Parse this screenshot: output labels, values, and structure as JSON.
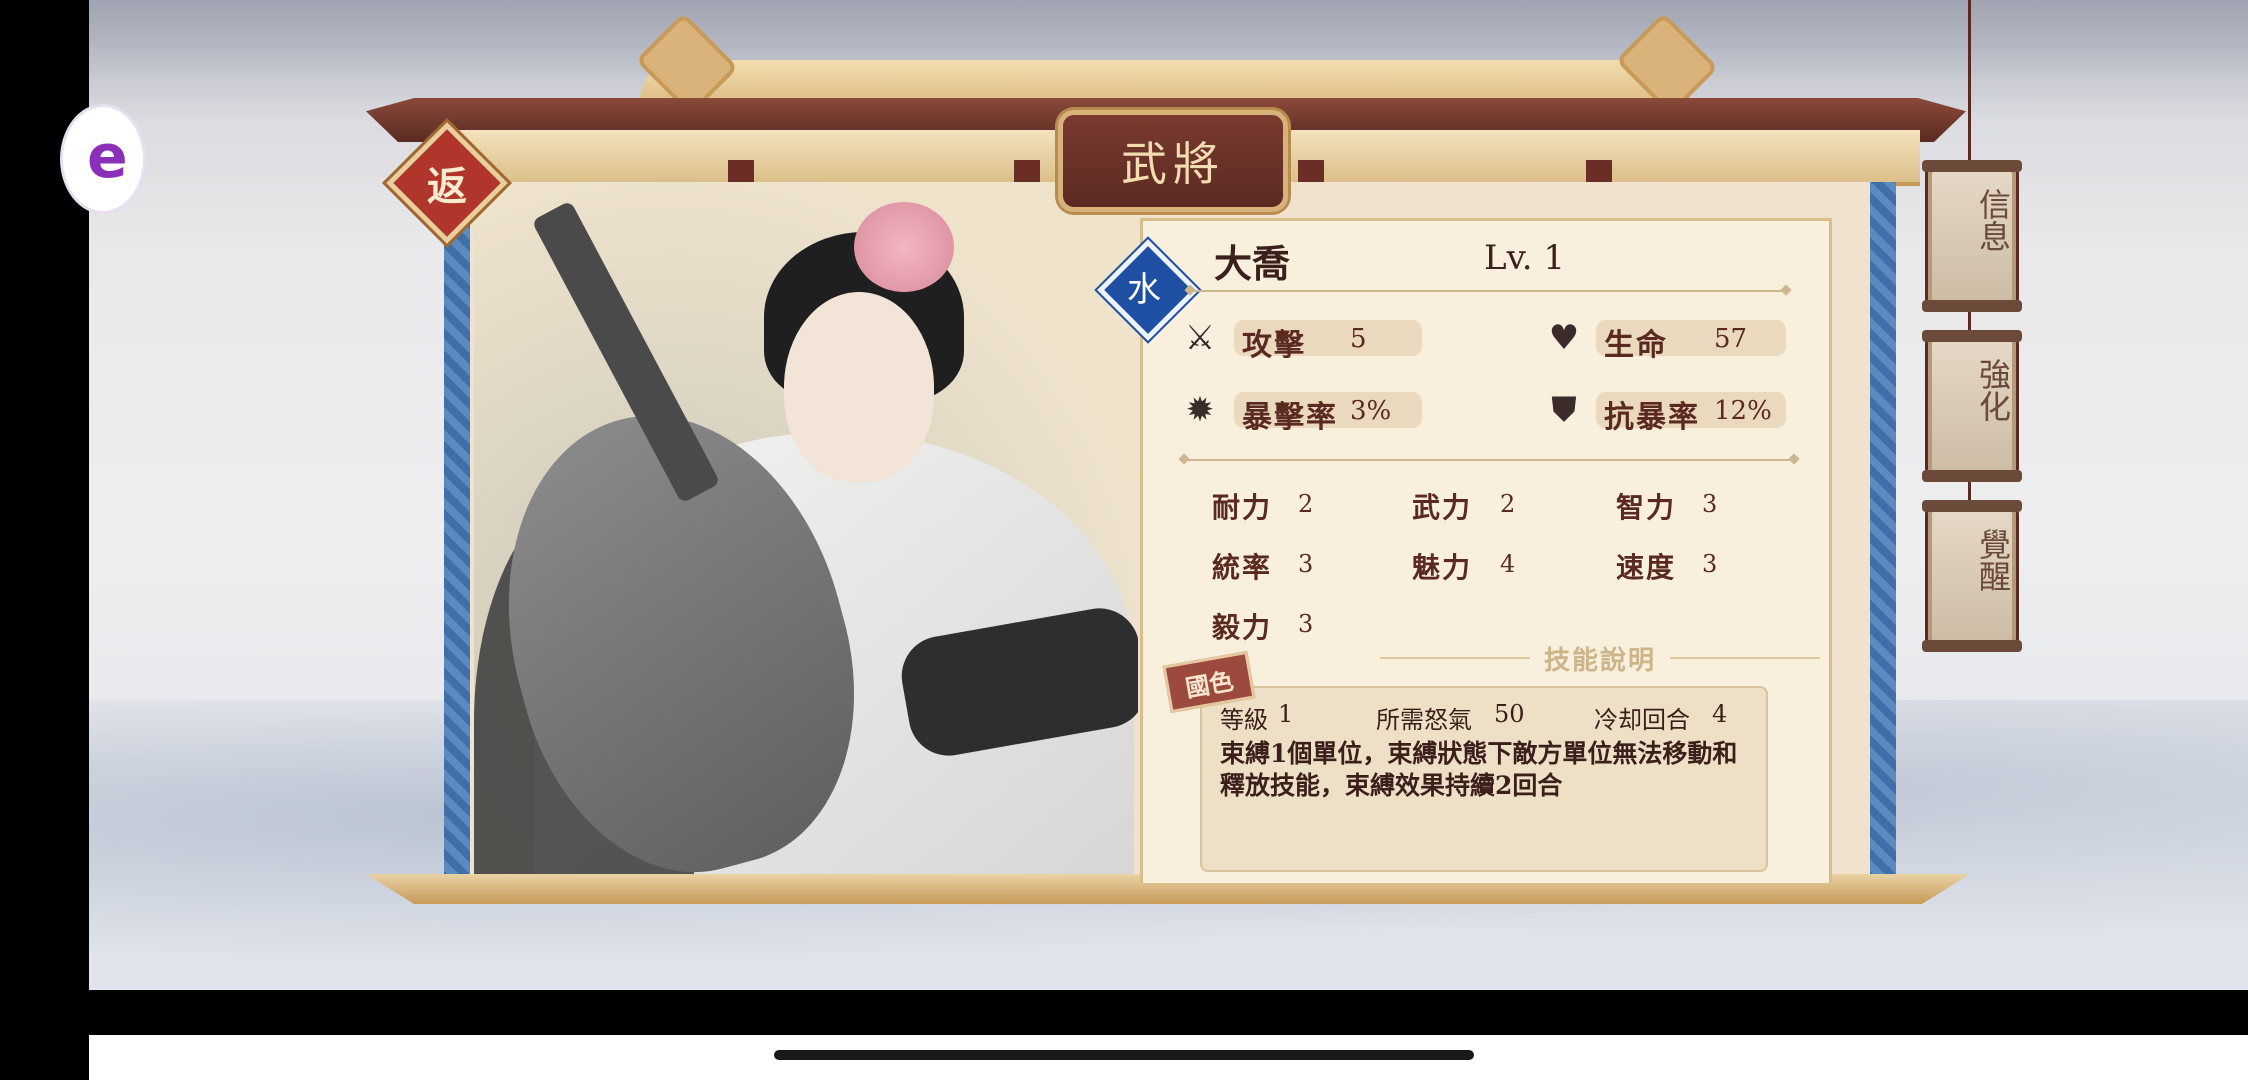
{
  "header": {
    "title": "武將",
    "back_label": "返",
    "user_badge_glyph": "e"
  },
  "hero": {
    "name": "大喬",
    "level": "Lv. 1",
    "element_glyph": "水"
  },
  "combat_stats": [
    {
      "icon": "sword-icon",
      "label": "攻擊",
      "value": "5"
    },
    {
      "icon": "heart-icon",
      "label": "生命",
      "value": "57"
    },
    {
      "icon": "burst-icon",
      "label": "暴擊率",
      "value": "3%"
    },
    {
      "icon": "shield-icon",
      "label": "抗暴率",
      "value": "12%"
    }
  ],
  "attributes": [
    {
      "label": "耐力",
      "value": "2"
    },
    {
      "label": "武力",
      "value": "2"
    },
    {
      "label": "智力",
      "value": "3"
    },
    {
      "label": "統率",
      "value": "3"
    },
    {
      "label": "魅力",
      "value": "4"
    },
    {
      "label": "速度",
      "value": "3"
    },
    {
      "label": "毅力",
      "value": "3"
    }
  ],
  "skill": {
    "section_title": "技能說明",
    "tag": "國色",
    "level_label": "等級",
    "level_value": "1",
    "rage_label": "所需怒氣",
    "rage_value": "50",
    "cooldown_label": "冷却回合",
    "cooldown_value": "4",
    "description": "束縛1個單位，束縛狀態下敵方單位無法移動和釋放技能，束縛效果持續2回合"
  },
  "side_tabs": [
    {
      "label": "信息"
    },
    {
      "label": "強化"
    },
    {
      "label": "覺醒"
    }
  ],
  "colors": {
    "element_blue": "#1e4fa3",
    "frame_red": "#5a2a22",
    "back_red": "#b0362c"
  }
}
